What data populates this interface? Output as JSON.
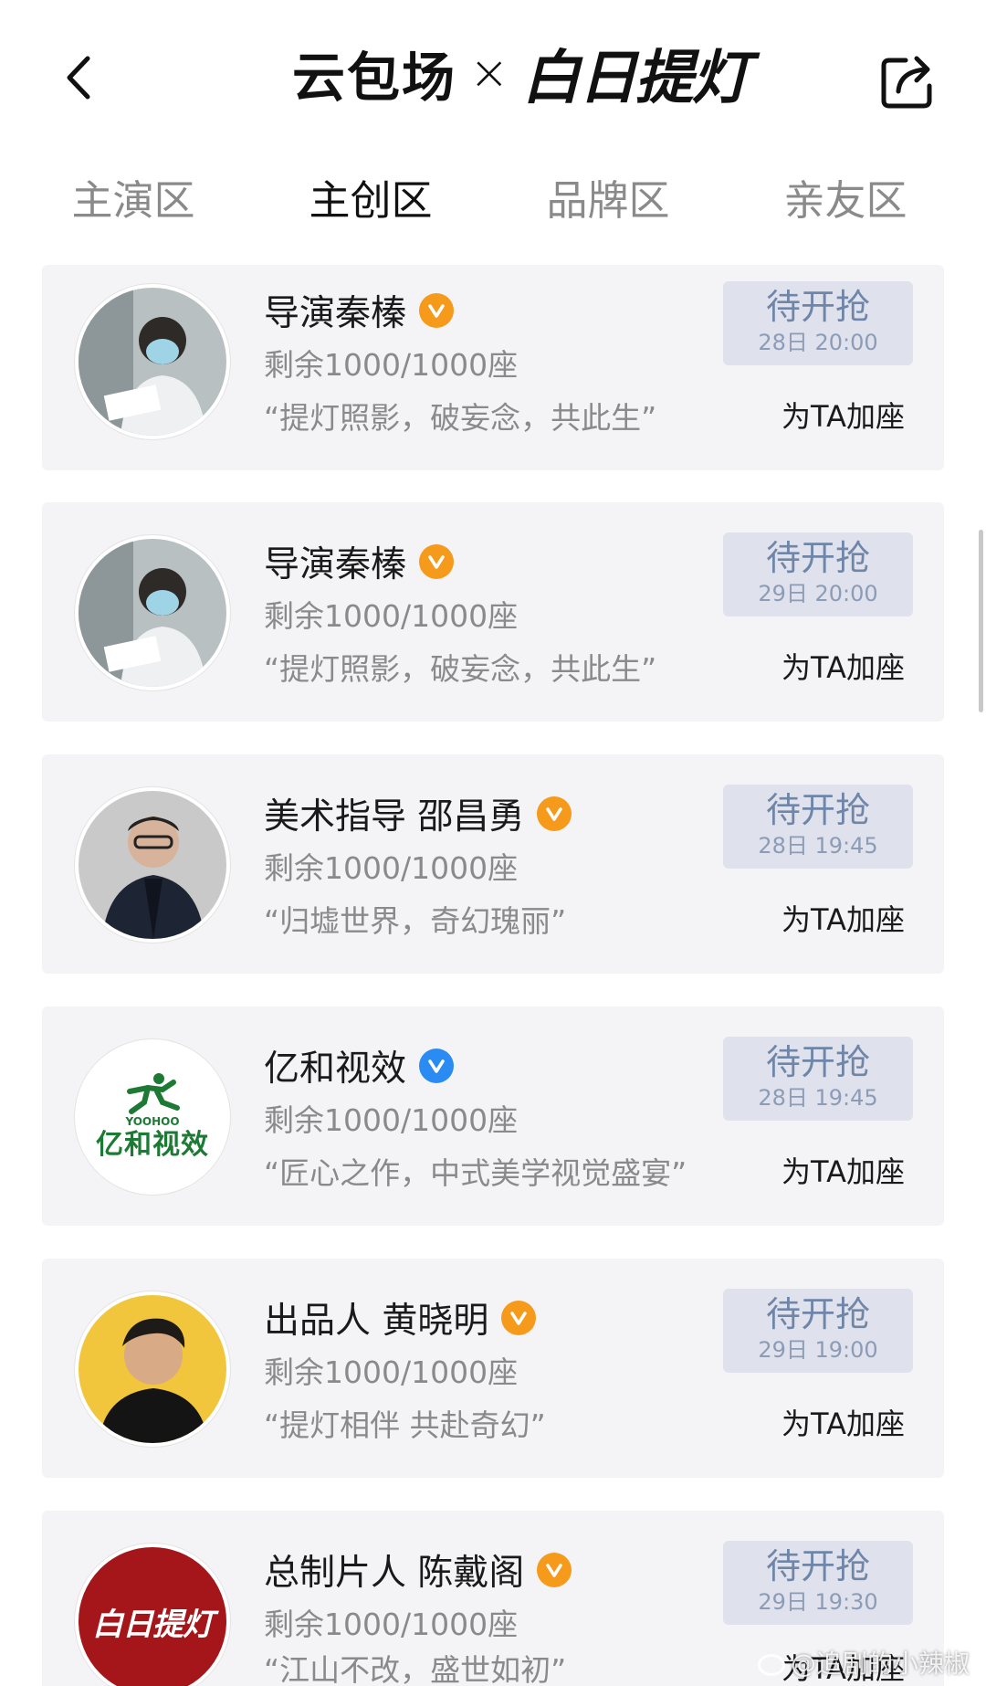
{
  "header": {
    "brand_left": "云包场",
    "brand_separator": "×",
    "brand_right": "白日提灯"
  },
  "tabs": [
    {
      "label": "主演区",
      "active": false
    },
    {
      "label": "主创区",
      "active": true
    },
    {
      "label": "品牌区",
      "active": false
    },
    {
      "label": "亲友区",
      "active": false
    }
  ],
  "cards": [
    {
      "name": "导演秦榛",
      "badge": "orange",
      "seats": "剩余1000/1000座",
      "quote": "“提灯照影，破妄念，共此生”",
      "button": "待开抢",
      "time": "28日 20:00",
      "action": "为TA加座",
      "avatar": "person-avatar"
    },
    {
      "name": "导演秦榛",
      "badge": "orange",
      "seats": "剩余1000/1000座",
      "quote": "“提灯照影，破妄念，共此生”",
      "button": "待开抢",
      "time": "29日 20:00",
      "action": "为TA加座",
      "avatar": "person-avatar"
    },
    {
      "name": "美术指导 邵昌勇",
      "badge": "orange",
      "seats": "剩余1000/1000座",
      "quote": "“归墟世界，奇幻瑰丽”",
      "button": "待开抢",
      "time": "28日 19:45",
      "action": "为TA加座",
      "avatar": "person-avatar"
    },
    {
      "name": "亿和视效",
      "badge": "blue",
      "seats": "剩余1000/1000座",
      "quote": "“匠心之作，中式美学视觉盛宴”",
      "button": "待开抢",
      "time": "28日 19:45",
      "action": "为TA加座",
      "avatar": "logo-avatar",
      "logo_text": "亿和视效",
      "logo_sub": "YOOHOO"
    },
    {
      "name": "出品人 黄晓明",
      "badge": "orange",
      "seats": "剩余1000/1000座",
      "quote": "“提灯相伴 共赴奇幻”",
      "button": "待开抢",
      "time": "29日 19:00",
      "action": "为TA加座",
      "avatar": "person-avatar"
    },
    {
      "name": "总制片人 陈戴阁",
      "badge": "orange",
      "seats": "剩余1000/1000座",
      "quote": "“江山不改，盛世如初”",
      "button": "待开抢",
      "time": "29日 19:30",
      "action": "为TA加座",
      "avatar": "logo-avatar",
      "logo_text": "白日提灯"
    }
  ],
  "watermark": "@追剧的小辣椒",
  "colors": {
    "card_bg": "#f4f4f6",
    "button_bg": "#dfe2ec",
    "button_text": "#6f86a8",
    "badge_orange": "#f59a1b",
    "badge_blue": "#2a8bf2",
    "logo_green": "#1d7a34",
    "logo_red": "#a5161a"
  }
}
